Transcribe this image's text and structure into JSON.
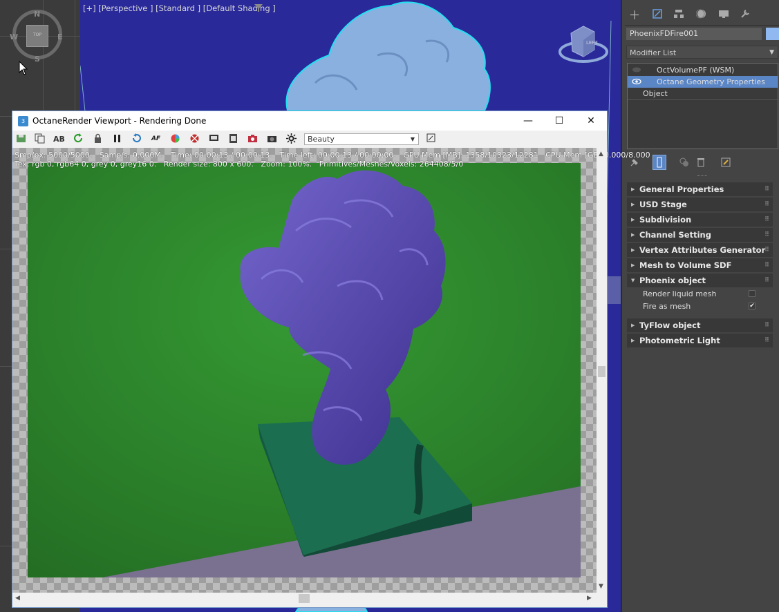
{
  "viewport": {
    "label": "[+] [Perspective ] [Standard ] [Default Shading ]",
    "compass": {
      "n": "N",
      "s": "S",
      "e": "E",
      "w": "W",
      "cube": "TOP"
    },
    "viewcube": "LEFT"
  },
  "octane_window": {
    "title": "OctaneRender Viewport - Rendering Done",
    "app_icon": "3",
    "buttons": {
      "minimize": "—",
      "maximize": "☐",
      "close": "✕"
    },
    "pass": "Beauty",
    "stats_line1": "Smp/px: 5000/5000.   Samp/s: 0.000M.   Time: 00:00:13 / 00:00:13.   Time left: 00:00:13 / 00:00:00.   GPU Mem [MB]: 1358/10323/12281   CPU Mem [GB]:0.000/8.000",
    "stats_line2": "Tex: rgb 0, rgb64 0, grey 0, grey16 0.   Render size: 800 x 600.   Zoom: 100%.   Primitives/Meshes/Voxels: 264408/5/0",
    "toolbar_icons": [
      "save-icon",
      "copy-icon",
      "ab-compare-icon",
      "refresh-icon",
      "lock-icon",
      "pause-icon",
      "restart-icon",
      "af-icon",
      "color-icon",
      "sync-icon",
      "display-icon",
      "film-icon",
      "camera-red-icon",
      "camera-icon",
      "settings-icon"
    ]
  },
  "panel": {
    "object_name": "PhoenixFDFire001",
    "object_color": "#8fb9f0",
    "modifier_list": "Modifier List",
    "stack": [
      {
        "label": "OctVolumePF (WSM)",
        "selected": false
      },
      {
        "label": "Octane Geometry Properties",
        "selected": true
      },
      {
        "label": "Object",
        "selected": false
      }
    ],
    "rollouts": [
      {
        "title": "General Properties",
        "open": false
      },
      {
        "title": "USD Stage",
        "open": false
      },
      {
        "title": "Subdivision",
        "open": false
      },
      {
        "title": "Channel Setting",
        "open": false
      },
      {
        "title": "Vertex Attributes Generator",
        "open": false
      },
      {
        "title": "Mesh to Volume SDF",
        "open": false
      },
      {
        "title": "Phoenix object",
        "open": true
      },
      {
        "title": "TyFlow object",
        "open": false
      },
      {
        "title": "Photometric Light",
        "open": false
      }
    ],
    "phoenix_props": [
      {
        "label": "Render liquid mesh",
        "checked": false
      },
      {
        "label": "Fire as mesh",
        "checked": true
      }
    ]
  },
  "colors": {
    "viewport_bg": "#29299a",
    "selection": "#5b86c6",
    "render_green": "#2f8a2d",
    "render_blob": "#5a4db0"
  }
}
